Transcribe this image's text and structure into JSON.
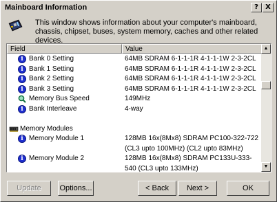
{
  "window": {
    "title": "Mainboard Information",
    "help_label": "?",
    "close_label": "X"
  },
  "header": {
    "description": "This window shows information about your computer's mainboard, chassis, chipset, buses, system memory, caches and other related devices."
  },
  "list": {
    "columns": [
      "Field",
      "Value"
    ],
    "rows": [
      {
        "icon": "info-icon",
        "field": "Bank 0 Setting",
        "value": "64MB SDRAM 6-1-1-1R 4-1-1-1W 2-3-2CL"
      },
      {
        "icon": "info-icon",
        "field": "Bank 1 Setting",
        "value": "64MB SDRAM 6-1-1-1R 4-1-1-1W 2-3-2CL"
      },
      {
        "icon": "info-icon",
        "field": "Bank 2 Setting",
        "value": "64MB SDRAM 6-1-1-1R 4-1-1-1W 2-3-2CL"
      },
      {
        "icon": "info-icon",
        "field": "Bank 3 Setting",
        "value": "64MB SDRAM 6-1-1-1R 4-1-1-1W 2-3-2CL"
      },
      {
        "icon": "magnifier-icon",
        "field": "Memory Bus Speed",
        "value": "149MHz"
      },
      {
        "icon": "info-icon",
        "field": "Bank Interleave",
        "value": "4-way"
      },
      {
        "icon": "",
        "field": "",
        "value": ""
      },
      {
        "icon": "memory-module-icon",
        "field": "Memory Modules",
        "value": "",
        "group": true
      },
      {
        "icon": "info-icon",
        "field": "Memory Module 1",
        "value": "128MB 16x(8Mx8) SDRAM PC100-322-722"
      },
      {
        "icon": "",
        "field": "",
        "value": "(CL3 upto 100MHz) (CL2 upto 83MHz)"
      },
      {
        "icon": "info-icon",
        "field": "Memory Module 2",
        "value": "128MB 16x(8Mx8) SDRAM PC133U-333-"
      },
      {
        "icon": "",
        "field": "",
        "value": "540 (CL3 upto 133MHz)"
      }
    ]
  },
  "scrollbar": {
    "up_glyph": "▲",
    "down_glyph": "▼"
  },
  "buttons": {
    "update": "Update",
    "options": "Options...",
    "back": "< Back",
    "next": "Next >",
    "ok": "OK"
  }
}
